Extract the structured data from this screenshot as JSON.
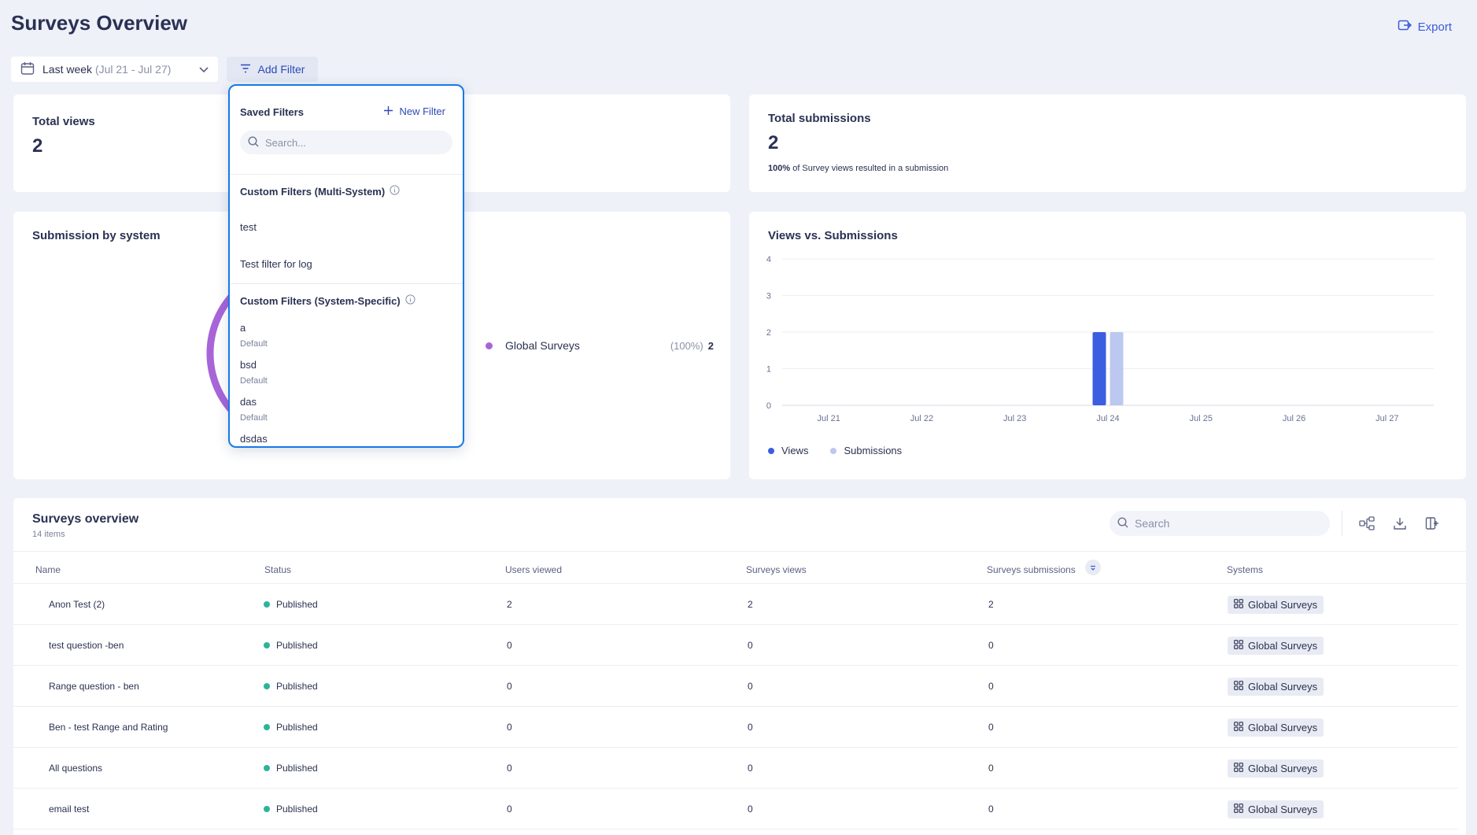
{
  "header": {
    "title": "Surveys Overview",
    "export_label": "Export"
  },
  "toolbar": {
    "date_label": "Last week",
    "date_range": "(Jul 21 - Jul 27)",
    "add_filter_label": "Add Filter"
  },
  "total_views": {
    "title": "Total views",
    "value": "2"
  },
  "total_submissions": {
    "title": "Total submissions",
    "value": "2",
    "note_bold": "100%",
    "note_rest": " of Survey views resulted in a submission"
  },
  "submission_by_system": {
    "title": "Submission by system",
    "legend": [
      {
        "label": "Global Surveys",
        "percent": "(100%)",
        "value": "2",
        "color": "#a765d8"
      }
    ]
  },
  "views_vs_submissions": {
    "title": "Views vs. Submissions",
    "legend_views": "Views",
    "legend_submissions": "Submissions"
  },
  "chart_data": {
    "type": "bar",
    "title": "Views vs. Submissions",
    "categories": [
      "Jul 21",
      "Jul 22",
      "Jul 23",
      "Jul 24",
      "Jul 25",
      "Jul 26",
      "Jul 27"
    ],
    "series": [
      {
        "name": "Views",
        "values": [
          0,
          0,
          0,
          2,
          0,
          0,
          0
        ],
        "color": "#3b5ee0"
      },
      {
        "name": "Submissions",
        "values": [
          0,
          0,
          0,
          2,
          0,
          0,
          0
        ],
        "color": "#bcc8ef"
      }
    ],
    "yticks": [
      "0",
      "1",
      "2",
      "3",
      "4"
    ],
    "ylim": [
      0,
      4
    ],
    "grid": true,
    "legend_position": "bottom-left"
  },
  "filters_dropdown": {
    "title": "Saved Filters",
    "new_filter_label": "New Filter",
    "search_placeholder": "Search...",
    "multi_system_title": "Custom Filters (Multi-System)",
    "multi_system_items": [
      "test",
      "Test filter for log"
    ],
    "system_specific_title": "Custom Filters (System-Specific)",
    "system_specific_items": [
      {
        "name": "a",
        "sub": "Default"
      },
      {
        "name": "bsd",
        "sub": "Default"
      },
      {
        "name": "das",
        "sub": "Default"
      },
      {
        "name": "dsdas",
        "sub": ""
      }
    ]
  },
  "table": {
    "title": "Surveys overview",
    "count": "14 items",
    "search_placeholder": "Search",
    "columns": [
      "Name",
      "Status",
      "Users viewed",
      "Surveys views",
      "Surveys submissions",
      "Systems"
    ],
    "rows": [
      {
        "name": "Anon Test (2)",
        "status": "Published",
        "users_viewed": "2",
        "views": "2",
        "submissions": "2",
        "system": "Global Surveys"
      },
      {
        "name": "test question -ben",
        "status": "Published",
        "users_viewed": "0",
        "views": "0",
        "submissions": "0",
        "system": "Global Surveys"
      },
      {
        "name": "Range question - ben",
        "status": "Published",
        "users_viewed": "0",
        "views": "0",
        "submissions": "0",
        "system": "Global Surveys"
      },
      {
        "name": "Ben - test Range and Rating",
        "status": "Published",
        "users_viewed": "0",
        "views": "0",
        "submissions": "0",
        "system": "Global Surveys"
      },
      {
        "name": "All questions",
        "status": "Published",
        "users_viewed": "0",
        "views": "0",
        "submissions": "0",
        "system": "Global Surveys"
      },
      {
        "name": "email test",
        "status": "Published",
        "users_viewed": "0",
        "views": "0",
        "submissions": "0",
        "system": "Global Surveys"
      }
    ]
  }
}
